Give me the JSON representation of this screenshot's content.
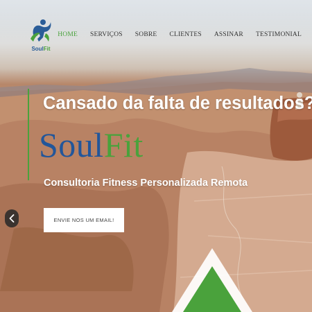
{
  "brand": {
    "logo_text_soul": "Soul",
    "logo_text_fit": "Fit",
    "primary_color": "#22569a",
    "accent_color": "#4aa23c"
  },
  "nav": {
    "items": [
      {
        "label": "HOME",
        "active": true
      },
      {
        "label": "SERVIÇOS",
        "active": false
      },
      {
        "label": "SOBRE",
        "active": false
      },
      {
        "label": "CLIENTES",
        "active": false
      },
      {
        "label": "ASSINAR",
        "active": false
      },
      {
        "label": "TESTIMONIAL",
        "active": false
      }
    ]
  },
  "hero": {
    "headline": "Cansado da falta de resultados?",
    "brand_soul": "Soul",
    "brand_fit": "Fit",
    "subtitle": "Consultoria Fitness Personalizada Remota",
    "cta_label": "ENVIE NOS UM EMAIL!",
    "prev_icon": "chevron-left-icon"
  }
}
